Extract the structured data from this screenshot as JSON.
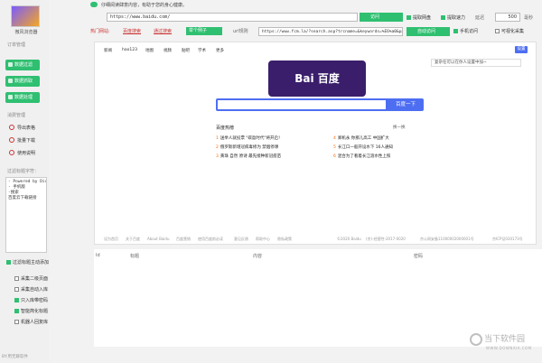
{
  "sidebar": {
    "caption": "微风浏览器",
    "group1_title": "订单管理",
    "buttons": [
      "数据过滤",
      "数据抓取",
      "数据处理"
    ],
    "group2_title": "消费管理",
    "items": [
      "导出表格",
      "批量下载",
      "使用说明"
    ],
    "notes_title": "过滤标题字符：",
    "notes_text": "- Powered by Discuz!\n- 手机版\n-搜索\n百度云下载链接",
    "filter_label": "过滤标题主动添加",
    "options": [
      {
        "label": "采集二级页面",
        "checked": false
      },
      {
        "label": "采集自动入库",
        "checked": false
      },
      {
        "label": "只入库带密码",
        "checked": true
      },
      {
        "label": "智能简化标题",
        "checked": true
      },
      {
        "label": "机器人回复库",
        "checked": false
      }
    ],
    "footer": "BY:用无聊软件"
  },
  "toolbar": {
    "banner": "仔细阅读肆意内容，有助于您的身心健康。",
    "url": "https://www.baidu.com/",
    "visit_label": "访问",
    "extract_pan": "提取网盘",
    "extract_speed": "提取速力",
    "speed_label": "延迟",
    "speed_value": "500",
    "speed_unit": "毫秒",
    "hot_label": "热门网站:",
    "hot_links": [
      "百度搜索",
      "通过搜索"
    ],
    "test_chip": "举个例子",
    "url2_label": "url规则",
    "url2": "https://www.fcm.la/?search.asp?trcname=&keywords=%E6%a0&page=",
    "auto_label": "自动访问",
    "mobile_label": "手机访问",
    "visual_label": "可视化采集"
  },
  "browser": {
    "nav": [
      "新闻",
      "hao123",
      "地图",
      "视频",
      "贴吧",
      "学术",
      "更多"
    ],
    "settings_label": "设置",
    "logo_text": "Bai 百度",
    "tip": "复杂任可以在你人设置中加~",
    "search_button": "百度一下",
    "hot_title": "百度热榜",
    "hot_refresh": "换一换",
    "hot_items": [
      {
        "rank": "1",
        "text": "送举人就投票 \"碳盈时代\"将开启！"
      },
      {
        "rank": "2",
        "text": "俄罗斯新增冠病毒修为 禁烟停课"
      },
      {
        "rank": "3",
        "text": "黄珠 自然 原诗 最先接种新冠疫苗"
      },
      {
        "rank": "4",
        "text": "郑机永 你那儿高工 中国扩大"
      },
      {
        "rank": "5",
        "text": "长江口一般开设水下 16人通知"
      },
      {
        "rank": "6",
        "text": "混合为了看着长江溶水性上照"
      }
    ],
    "footer_links": [
      "设为首页",
      "关于百度",
      "About Baidu",
      "百度营销",
      "使用百度前必读",
      "意见反馈",
      "帮助中心",
      "隐私政策",
      "©2020 Baidu",
      "(京)-经营性-2017-0020",
      "京公网安备11000002000001号",
      "京ICP证030173号"
    ]
  },
  "table": {
    "headers": [
      "Id",
      "标题",
      "内容",
      "密码"
    ]
  },
  "watermark": {
    "text": "当下软件园",
    "sub": "WWW.DOWNXIA.COM"
  }
}
